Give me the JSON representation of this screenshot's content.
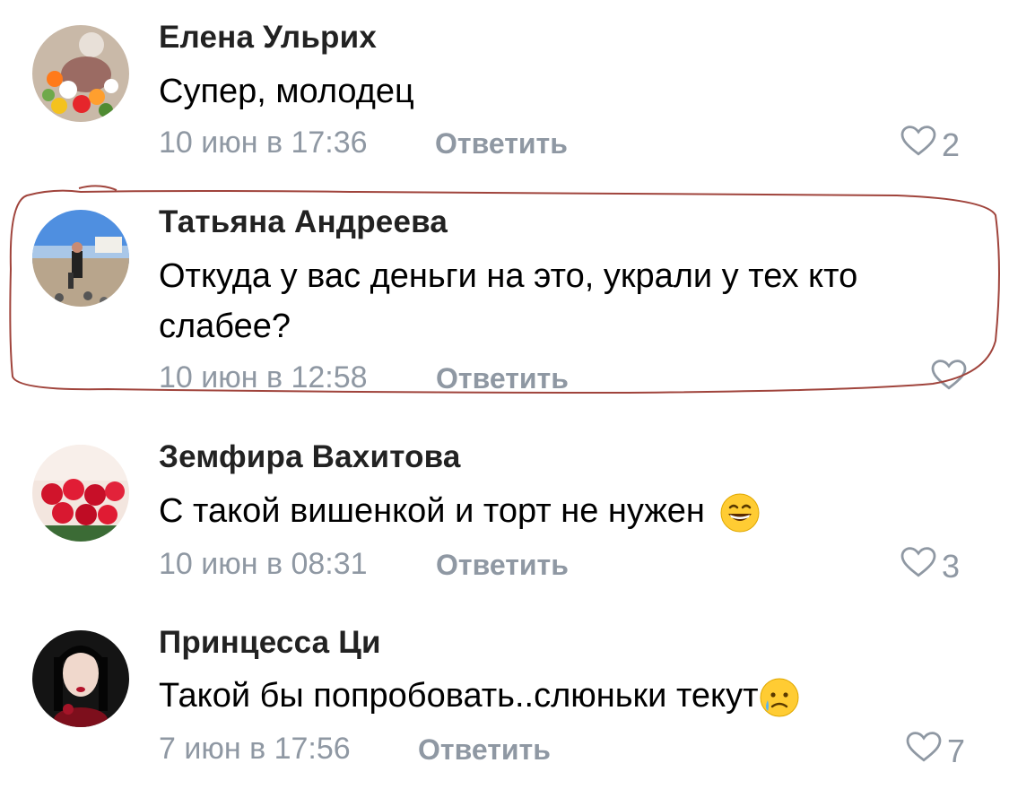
{
  "comments": [
    {
      "author": "Елена Ульрих",
      "text": "Супер, молодец",
      "emoji": "",
      "date": "10 июн в 17:36",
      "reply": "Ответить",
      "likes": "2"
    },
    {
      "author": "Татьяна Андреева",
      "text": "Откуда у вас деньги на это, украли у тех кто слабее?",
      "emoji": "",
      "date": "10 июн в 12:58",
      "reply": "Ответить",
      "likes": ""
    },
    {
      "author": "Земфира Вахитова",
      "text": "С такой вишенкой и торт не нужен",
      "emoji": "grinning-face",
      "date": "10 июн в 08:31",
      "reply": "Ответить",
      "likes": "3"
    },
    {
      "author": "Принцесса Ци",
      "text": "Такой бы попробовать..слюньки текут",
      "emoji": "sad-but-relieved-face",
      "date": "7 июн в 17:56",
      "reply": "Ответить",
      "likes": "7"
    }
  ],
  "colors": {
    "meta": "#8f98a3",
    "highlight": "#a0443c"
  }
}
